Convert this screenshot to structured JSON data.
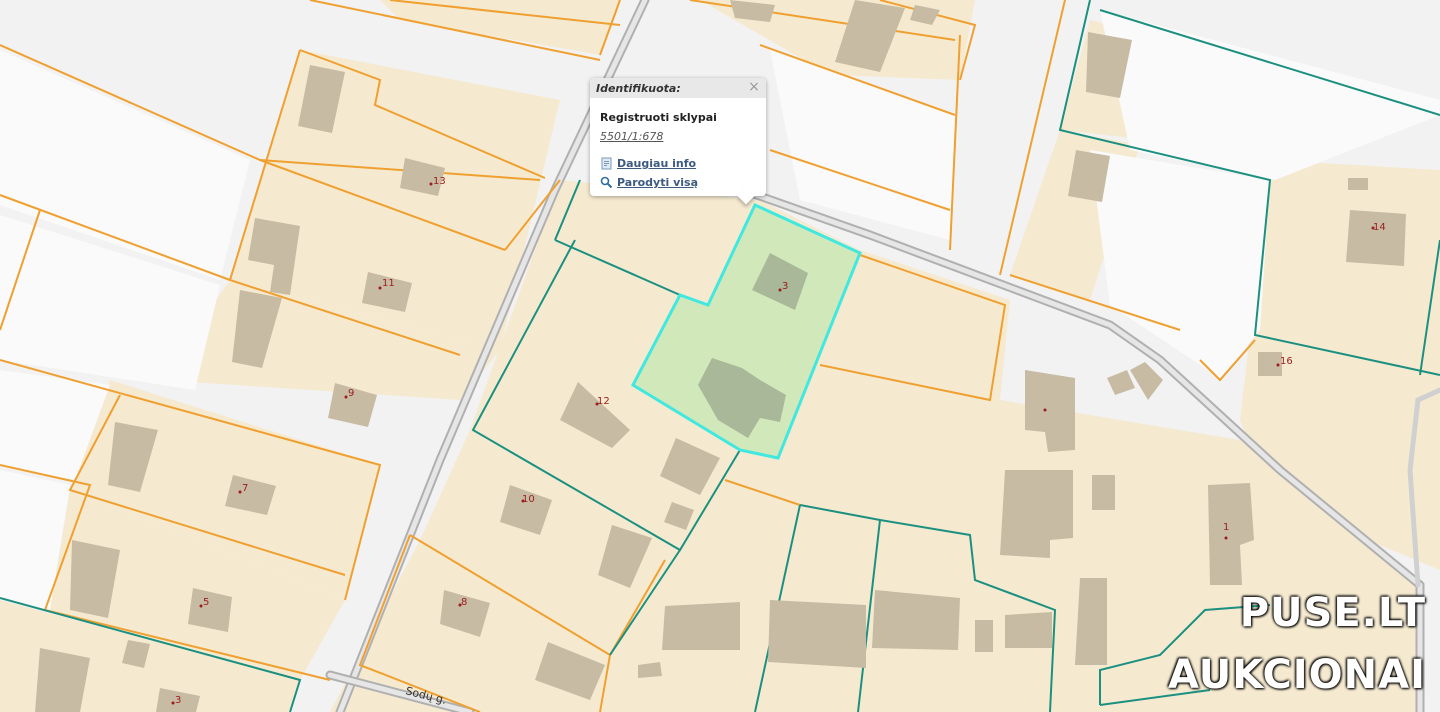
{
  "popup": {
    "title": "Identifikuota:",
    "close": "×",
    "layer": "Registruoti sklypai",
    "parcel_id": "5501/1:678",
    "more_info": "Daugiau info",
    "show_all": "Parodyti visą"
  },
  "map": {
    "road_name": "Sodų g.",
    "house_numbers": [
      "13",
      "11",
      "9",
      "7",
      "5",
      "3",
      "12",
      "10",
      "8",
      "3",
      "14",
      "16",
      "1"
    ]
  },
  "colors": {
    "parcel_fill": "#f5ead0",
    "orange_border": "#f0a030",
    "teal_border": "#1c9080",
    "selected_fill": "#cde8b8",
    "selected_border": "#40e8e0",
    "building": "#c8bba4",
    "road": "#b8b8b8"
  },
  "watermark": {
    "line1": "PUSE.LT",
    "line2": "AUKCIONAI"
  }
}
